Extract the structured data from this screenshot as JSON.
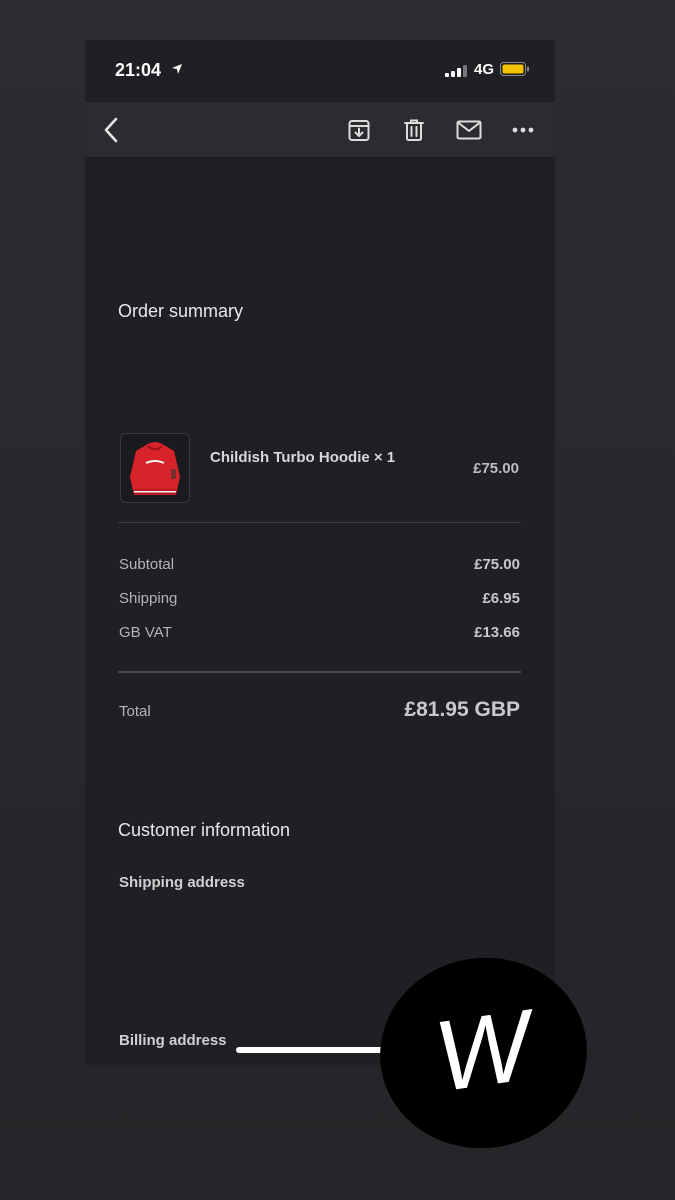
{
  "status_bar": {
    "time": "21:04",
    "network": "4G"
  },
  "toolbar": {
    "icons": [
      "back-icon",
      "archive-icon",
      "trash-icon",
      "mail-icon",
      "more-icon"
    ]
  },
  "order_summary": {
    "title": "Order summary",
    "item": {
      "name": "Childish Turbo Hoodie × 1",
      "price": "£75.00"
    },
    "subtotal_label": "Subtotal",
    "subtotal_value": "£75.00",
    "shipping_label": "Shipping",
    "shipping_value": "£6.95",
    "vat_label": "GB VAT",
    "vat_value": "£13.66",
    "total_label": "Total",
    "total_value": "£81.95 GBP"
  },
  "customer_information": {
    "title": "Customer information",
    "shipping_address_label": "Shipping address",
    "billing_address_label": "Billing address"
  },
  "watermark": {
    "letter": "W"
  },
  "colors": {
    "background": "#26282c",
    "panel": "#1f2023",
    "toolbar": "#2b2c30",
    "battery": "#f2c500",
    "hoodie": "#d8232a"
  }
}
